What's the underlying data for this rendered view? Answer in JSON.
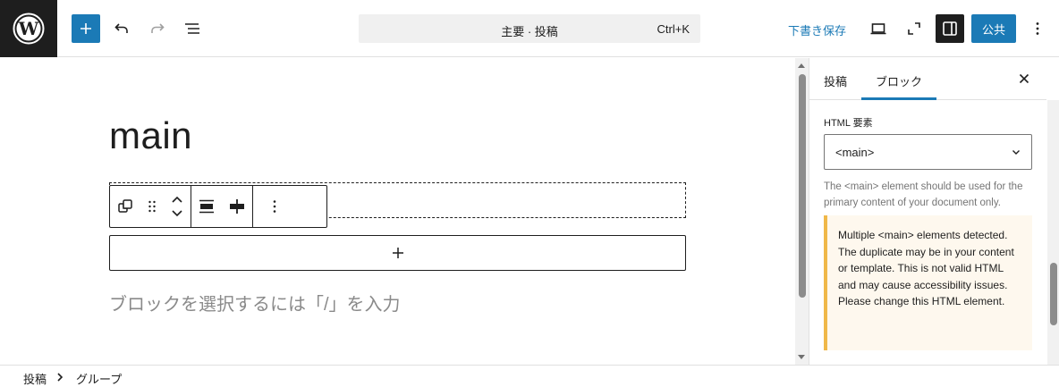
{
  "topbar": {
    "logo_icon": "wordpress-logo",
    "add_icon": "plus-icon",
    "undo_icon": "undo-icon",
    "redo_icon": "redo-icon",
    "listview_icon": "list-view-icon",
    "command_title": "主要 · 投稿",
    "command_shortcut": "Ctrl+K",
    "save_draft": "下書き保存",
    "preview_icon": "desktop-icon",
    "fullscreen_icon": "fullscreen-icon",
    "settings_icon": "sidebar-icon",
    "publish": "公共",
    "options_icon": "more-vertical-icon",
    "accent_color": "#1b7ab6"
  },
  "canvas": {
    "post_title": "main",
    "block_toolbar": {
      "icons": [
        "group-icon",
        "drag-handle-icon",
        "move-up-icon",
        "move-down-icon",
        "align-wide-icon",
        "justify-icon",
        "more-vertical-icon"
      ]
    },
    "appender_icon": "plus-icon",
    "placeholder": "ブロックを選択するには「/」を入力"
  },
  "sidebar": {
    "tabs": [
      {
        "label": "投稿",
        "active": false
      },
      {
        "label": "ブロック",
        "active": true
      }
    ],
    "close_icon": "close-icon",
    "html_element_label": "HTML 要素",
    "html_element_value": "<main>",
    "help_text": "The <main> element should be used for the primary content of your document only.",
    "notice_text": "Multiple <main> elements detected. The duplicate may be in your content or template. This is not valid HTML and may cause accessibility issues. Please change this HTML element.",
    "notice_color": "#f0b849"
  },
  "breadcrumb": {
    "items": [
      "投稿",
      "グループ"
    ],
    "separator_icon": "chevron-right-icon"
  }
}
